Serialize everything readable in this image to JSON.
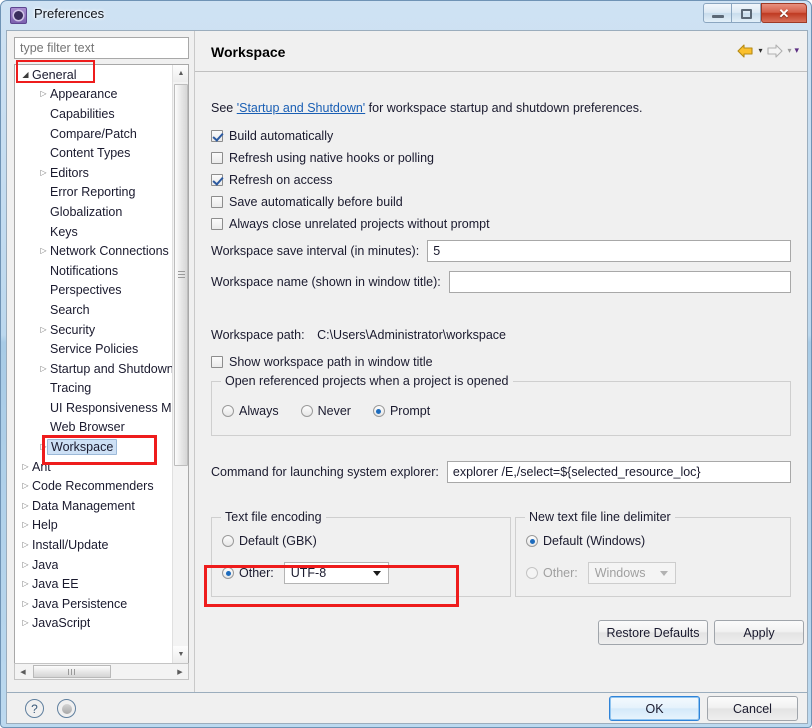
{
  "window": {
    "title": "Preferences",
    "icon": "preferences-gear-icon",
    "buttons": {
      "minimize": "–",
      "maximize": "□",
      "close": "✕"
    }
  },
  "sidebar": {
    "filter": {
      "placeholder": "type filter text",
      "value": ""
    },
    "items": [
      {
        "label": "General",
        "level": 1,
        "arrow": "open",
        "selected": false,
        "highlighted": true
      },
      {
        "label": "Appearance",
        "level": 2,
        "arrow": "closed",
        "selected": false,
        "highlighted": false
      },
      {
        "label": "Capabilities",
        "level": 2,
        "arrow": "none",
        "selected": false,
        "highlighted": false
      },
      {
        "label": "Compare/Patch",
        "level": 2,
        "arrow": "none",
        "selected": false,
        "highlighted": false
      },
      {
        "label": "Content Types",
        "level": 2,
        "arrow": "none",
        "selected": false,
        "highlighted": false
      },
      {
        "label": "Editors",
        "level": 2,
        "arrow": "closed",
        "selected": false,
        "highlighted": false
      },
      {
        "label": "Error Reporting",
        "level": 2,
        "arrow": "none",
        "selected": false,
        "highlighted": false
      },
      {
        "label": "Globalization",
        "level": 2,
        "arrow": "none",
        "selected": false,
        "highlighted": false
      },
      {
        "label": "Keys",
        "level": 2,
        "arrow": "none",
        "selected": false,
        "highlighted": false
      },
      {
        "label": "Network Connections",
        "level": 2,
        "arrow": "closed",
        "selected": false,
        "highlighted": false
      },
      {
        "label": "Notifications",
        "level": 2,
        "arrow": "none",
        "selected": false,
        "highlighted": false
      },
      {
        "label": "Perspectives",
        "level": 2,
        "arrow": "none",
        "selected": false,
        "highlighted": false
      },
      {
        "label": "Search",
        "level": 2,
        "arrow": "none",
        "selected": false,
        "highlighted": false
      },
      {
        "label": "Security",
        "level": 2,
        "arrow": "closed",
        "selected": false,
        "highlighted": false
      },
      {
        "label": "Service Policies",
        "level": 2,
        "arrow": "none",
        "selected": false,
        "highlighted": false
      },
      {
        "label": "Startup and Shutdown",
        "level": 2,
        "arrow": "closed",
        "selected": false,
        "highlighted": false
      },
      {
        "label": "Tracing",
        "level": 2,
        "arrow": "none",
        "selected": false,
        "highlighted": false
      },
      {
        "label": "UI Responsiveness Monitoring",
        "level": 2,
        "arrow": "none",
        "selected": false,
        "highlighted": false
      },
      {
        "label": "Web Browser",
        "level": 2,
        "arrow": "none",
        "selected": false,
        "highlighted": false
      },
      {
        "label": "Workspace",
        "level": 2,
        "arrow": "closed",
        "selected": true,
        "highlighted": true
      },
      {
        "label": "Ant",
        "level": 1,
        "arrow": "closed",
        "selected": false,
        "highlighted": false
      },
      {
        "label": "Code Recommenders",
        "level": 1,
        "arrow": "closed",
        "selected": false,
        "highlighted": false
      },
      {
        "label": "Data Management",
        "level": 1,
        "arrow": "closed",
        "selected": false,
        "highlighted": false
      },
      {
        "label": "Help",
        "level": 1,
        "arrow": "closed",
        "selected": false,
        "highlighted": false
      },
      {
        "label": "Install/Update",
        "level": 1,
        "arrow": "closed",
        "selected": false,
        "highlighted": false
      },
      {
        "label": "Java",
        "level": 1,
        "arrow": "closed",
        "selected": false,
        "highlighted": false
      },
      {
        "label": "Java EE",
        "level": 1,
        "arrow": "closed",
        "selected": false,
        "highlighted": false
      },
      {
        "label": "Java Persistence",
        "level": 1,
        "arrow": "closed",
        "selected": false,
        "highlighted": false
      },
      {
        "label": "JavaScript",
        "level": 1,
        "arrow": "closed",
        "selected": false,
        "highlighted": false
      }
    ]
  },
  "page": {
    "title": "Workspace",
    "nav": {
      "back_icon": "back-arrow-icon",
      "back_caret": "▾",
      "forward_icon": "forward-arrow-icon",
      "forward_caret": "▾",
      "menu_caret": "▾"
    },
    "intro": {
      "prefix": "See ",
      "link": "'Startup and Shutdown'",
      "suffix": " for workspace startup and shutdown preferences."
    },
    "checkboxes": [
      {
        "label": "Build automatically",
        "checked": true
      },
      {
        "label": "Refresh using native hooks or polling",
        "checked": false
      },
      {
        "label": "Refresh on access",
        "checked": true
      },
      {
        "label": "Save automatically before build",
        "checked": false
      },
      {
        "label": "Always close unrelated projects without prompt",
        "checked": false
      }
    ],
    "save_interval": {
      "label": "Workspace save interval (in minutes):",
      "value": "5"
    },
    "workspace_name": {
      "label": "Workspace name (shown in window title):",
      "value": ""
    },
    "workspace_path": {
      "label": "Workspace path:",
      "value": "C:\\Users\\Administrator\\workspace"
    },
    "show_path": {
      "label": "Show workspace path in window title",
      "checked": false
    },
    "open_referenced": {
      "title": "Open referenced projects when a project is opened",
      "options": [
        {
          "label": "Always",
          "selected": false
        },
        {
          "label": "Never",
          "selected": false
        },
        {
          "label": "Prompt",
          "selected": true
        }
      ]
    },
    "explorer_command": {
      "label": "Command for launching system explorer:",
      "value": "explorer /E,/select=${selected_resource_loc}"
    },
    "text_file_encoding": {
      "title": "Text file encoding",
      "default_option": {
        "label": "Default (GBK)",
        "selected": false
      },
      "other_option": {
        "label": "Other:",
        "selected": true
      },
      "combo_value": "UTF-8"
    },
    "line_delimiter": {
      "title": "New text file line delimiter",
      "default_option": {
        "label": "Default (Windows)",
        "selected": true
      },
      "other_option": {
        "label": "Other:",
        "selected": false,
        "disabled": true
      },
      "combo_value": "Windows",
      "combo_disabled": true
    },
    "restore_defaults_label": "Restore Defaults",
    "apply_label": "Apply"
  },
  "footer": {
    "help_icon": "?",
    "status_icon": "status-circle-icon",
    "ok_label": "OK",
    "cancel_label": "Cancel"
  },
  "annotations": {
    "color": "#ee1c1c",
    "boxes": [
      "general-tree-item",
      "workspace-tree-item",
      "text-file-encoding-other"
    ]
  }
}
